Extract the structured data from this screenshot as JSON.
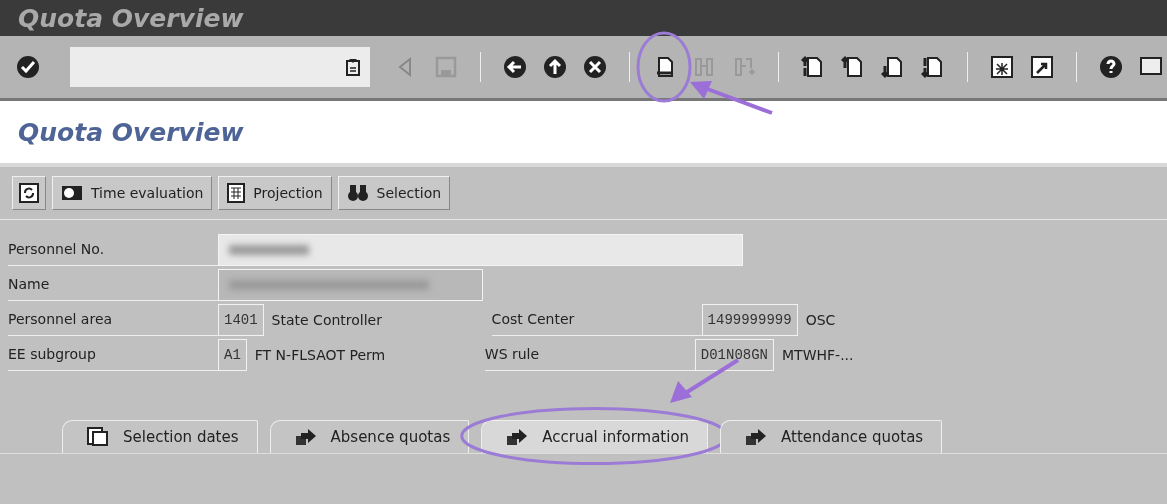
{
  "window": {
    "title": "Quota Overview"
  },
  "screen_title": "Quota Overview",
  "app_toolbar": [
    {
      "label": "Time evaluation"
    },
    {
      "label": "Projection"
    },
    {
      "label": "Selection"
    }
  ],
  "fields": [
    {
      "kind": "redacted",
      "label": "Personnel No."
    },
    {
      "kind": "redacted",
      "label": "Name"
    },
    {
      "kind": "detail",
      "label": "Personnel area",
      "code": "1401",
      "text": "State Controller",
      "label_2": "Cost Center",
      "code_2": "1499999999",
      "text_2": "OSC"
    },
    {
      "kind": "detail",
      "label": "EE subgroup",
      "code": "A1",
      "text": "FT N-FLSAOT Perm",
      "label_2": "WS rule",
      "code_2": "D01N08GN",
      "text_2": "MTWHF-..."
    }
  ],
  "tabs": [
    {
      "label": "Selection dates",
      "selected": false
    },
    {
      "label": "Absence quotas",
      "selected": false
    },
    {
      "label": "Accrual information",
      "selected": true
    },
    {
      "label": "Attendance quotas",
      "selected": false
    }
  ]
}
